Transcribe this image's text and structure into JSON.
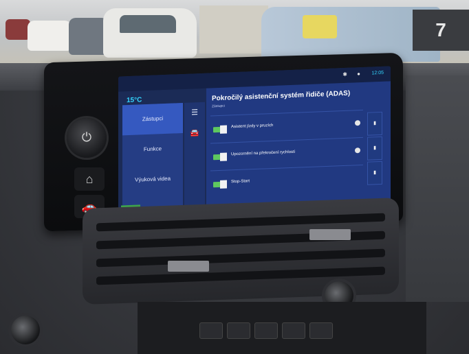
{
  "screen": {
    "temperature": "15°C",
    "clock": "12:05",
    "left_nav": [
      {
        "label": "Zástupci",
        "active": true
      },
      {
        "label": "Funkce",
        "active": false
      },
      {
        "label": "Výuková videa",
        "active": false
      }
    ],
    "panel": {
      "title": "Pokročilý asistenční systém řidiče (ADAS)",
      "subtitle": "Zástupci",
      "rows": [
        {
          "label": "Asistent jízdy v pruzích",
          "toggle_on": true
        },
        {
          "label": "Upozornění na překročení rychlosti",
          "toggle_on": true
        },
        {
          "label": "Stop-Start",
          "toggle_on": true
        }
      ]
    },
    "icons": {
      "menu": "hamburger-icon",
      "car": "car-icon",
      "bluetooth": "bluetooth-icon",
      "profile": "person-icon",
      "info": "info-icon",
      "bookmark": "bookmark-icon"
    },
    "colors": {
      "accent": "#34d6ff",
      "toggle": "#5ec85f",
      "panel": "#213981",
      "nav_active": "#3559c0"
    }
  },
  "hardware": {
    "power_icon": "power-icon",
    "home_icon": "home-icon",
    "car_button_icon": "car-icon",
    "sign_text": "7"
  }
}
